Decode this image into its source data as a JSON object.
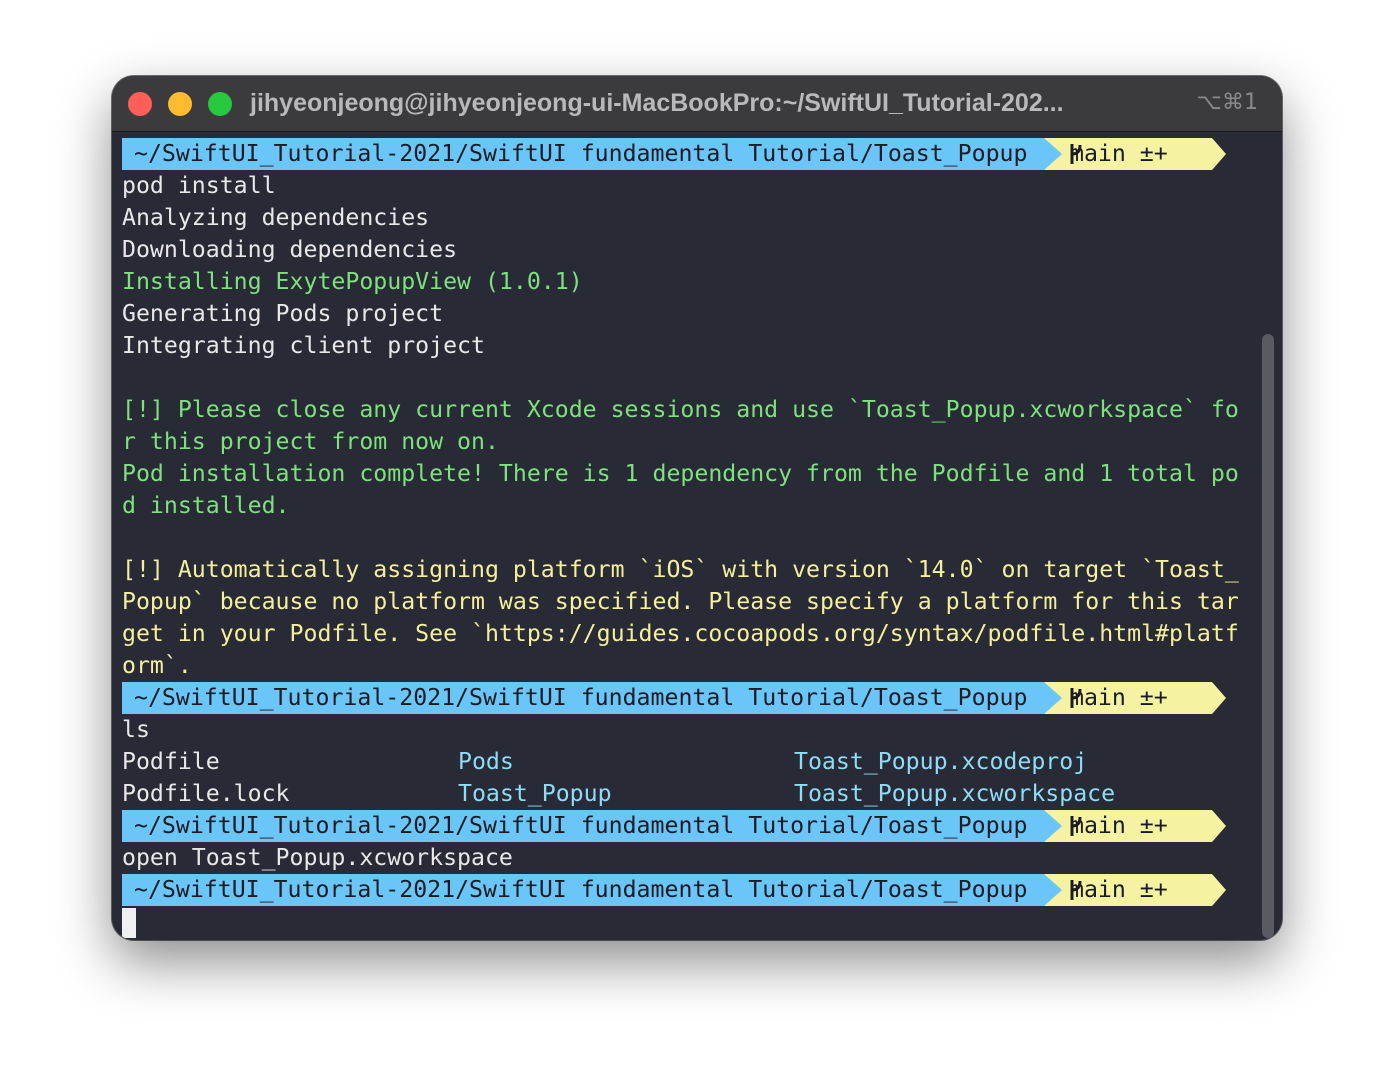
{
  "window": {
    "title": "jihyeonjeong@jihyeonjeong-ui-MacBookPro:~/SwiftUI_Tutorial-202...",
    "shortcut": "⌥⌘1"
  },
  "prompt": {
    "path": "~/SwiftUI_Tutorial-2021/SwiftUI fundamental Tutorial/Toast_Popup",
    "branch": "main ±+"
  },
  "lines": {
    "cmd1": "pod install",
    "l1": "Analyzing dependencies",
    "l2": "Downloading dependencies",
    "l3": "Installing ExytePopupView (1.0.1)",
    "l4": "Generating Pods project",
    "l5": "Integrating client project",
    "g1": "[!] Please close any current Xcode sessions and use `Toast_Popup.xcworkspace` fo",
    "g2": "r this project from now on.",
    "g3": "Pod installation complete! There is 1 dependency from the Podfile and 1 total po",
    "g4": "d installed.",
    "y1": "[!] Automatically assigning platform `iOS` with version `14.0` on target `Toast_",
    "y2": "Popup` because no platform was specified. Please specify a platform for this tar",
    "y3": "get in your Podfile. See `https://guides.cocoapods.org/syntax/podfile.html#platf",
    "y4": "orm`.",
    "cmd2": "ls",
    "cmd3": "open Toast_Popup.xcworkspace"
  },
  "ls_output": {
    "r1c1": "Podfile",
    "r1c2": "Pods",
    "r1c3": "Toast_Popup.xcodeproj",
    "r2c1": "Podfile.lock",
    "r2c2": "Toast_Popup",
    "r2c3": "Toast_Popup.xcworkspace"
  },
  "colors": {
    "background": "#282a36",
    "prompt_path_bg": "#6ac5f9",
    "prompt_git_bg": "#f5f3a1",
    "success_text": "#7ee17e",
    "warning_text": "#f3ef9d",
    "directory_text": "#8fdcf6"
  }
}
